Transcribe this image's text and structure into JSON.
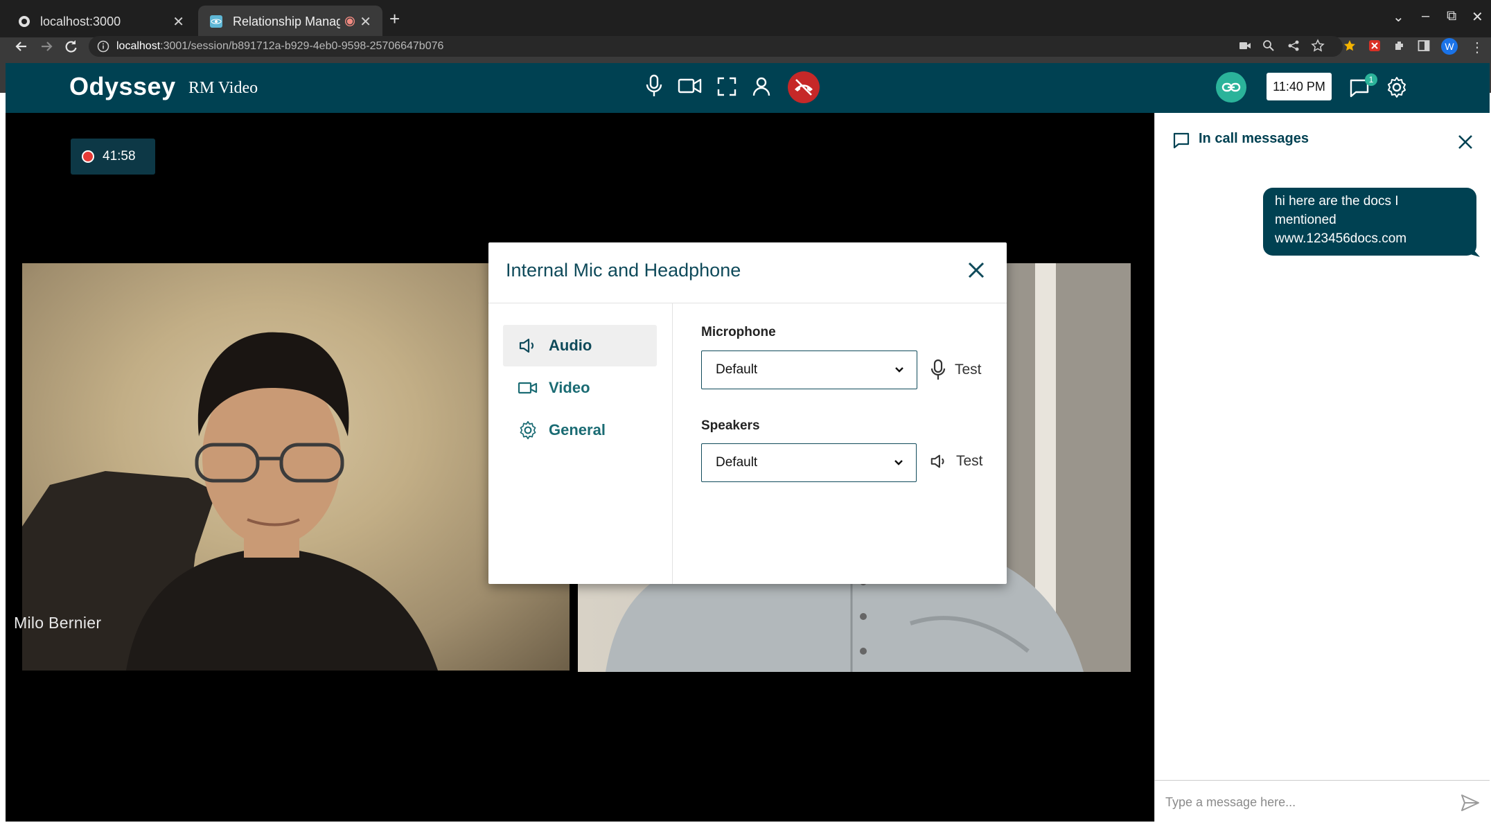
{
  "browser": {
    "tabs": [
      {
        "title": "localhost:3000",
        "active": false
      },
      {
        "title": "Relationship Manager",
        "active": true
      }
    ],
    "url_host": "localhost",
    "url_path": ":3001/session/b891712a-b929-4eb0-9598-25706647b076",
    "profile_initial": "W"
  },
  "app": {
    "logo": "Odyssey",
    "logo_sub": "RM Video",
    "time": "11:40 PM",
    "chat_badge": "1",
    "colors": {
      "brand": "#004152",
      "accent": "#2bb39a",
      "danger": "#c62828"
    }
  },
  "call": {
    "recording_time": "41:58",
    "participant_name": "Milo Bernier"
  },
  "chat": {
    "title": "In call messages",
    "messages": [
      {
        "line1": "hi here are the docs I",
        "line2": "mentioned",
        "line3": "www.123456docs.com"
      }
    ],
    "placeholder": "Type a message here..."
  },
  "modal": {
    "title": "Internal Mic and Headphone",
    "nav": [
      {
        "label": "Audio",
        "icon": "speaker-icon",
        "active": true
      },
      {
        "label": "Video",
        "icon": "camera-icon",
        "active": false
      },
      {
        "label": "General",
        "icon": "gear-icon",
        "active": false
      }
    ],
    "microphone_label": "Microphone",
    "microphone_value": "Default",
    "speakers_label": "Speakers",
    "speakers_value": "Default",
    "test_label": "Test"
  }
}
